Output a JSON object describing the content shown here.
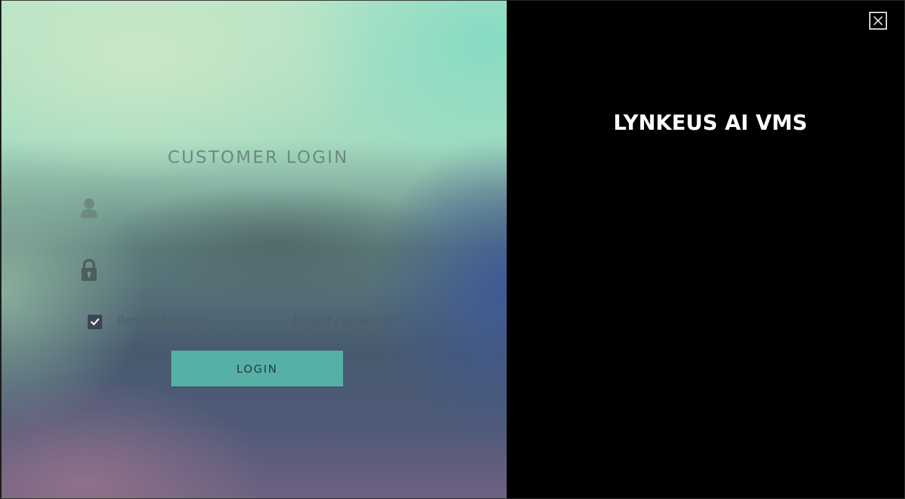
{
  "login": {
    "title": "CUSTOMER LOGIN",
    "username": {
      "value": "",
      "placeholder": "",
      "icon": "user-icon"
    },
    "password": {
      "value": "",
      "placeholder": "",
      "icon": "lock-icon"
    },
    "remember_me": {
      "label": "Remember me",
      "checked": true
    },
    "forgot_password": "Forgot Password?",
    "login_button": "LOGIN"
  },
  "brand": {
    "title": "LYNKEUS AI VMS"
  },
  "window": {
    "close_icon": "close-icon"
  },
  "colors": {
    "title_text": "#6b8a80",
    "button_bg": "#56b0a6",
    "checkbox_bg": "#3b4556",
    "brand_bg": "#000000",
    "brand_text": "#ffffff"
  }
}
